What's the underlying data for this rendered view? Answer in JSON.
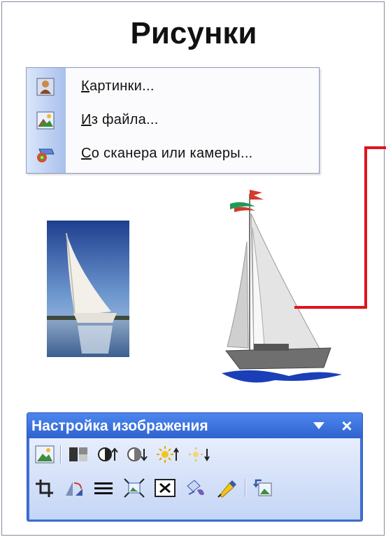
{
  "slide": {
    "title": "Рисунки"
  },
  "insert_menu": {
    "items": [
      {
        "pre": "",
        "accel": "К",
        "post": "артинки...",
        "icon": "clip-art-icon"
      },
      {
        "pre": "",
        "accel": "И",
        "post": "з файла...",
        "icon": "from-file-icon"
      },
      {
        "pre": "",
        "accel": "С",
        "post": "о сканера или камеры...",
        "icon": "scanner-camera-icon"
      }
    ]
  },
  "toolbar": {
    "title": "Настройка изображения",
    "close_glyph": "×",
    "row1": [
      "insert-picture-icon",
      "color-icon",
      "more-contrast-icon",
      "less-contrast-icon",
      "more-brightness-icon",
      "less-brightness-icon"
    ],
    "row2": [
      "crop-icon",
      "rotate-left-icon",
      "line-style-icon",
      "compress-pictures-icon",
      "text-wrapping-icon",
      "format-picture-icon",
      "set-transparent-color-icon",
      "reset-picture-icon"
    ]
  },
  "colors": {
    "toolbar_blue": "#3f72d9",
    "connector_red": "#e0141c",
    "menu_gutter": "#a8c0ec"
  }
}
